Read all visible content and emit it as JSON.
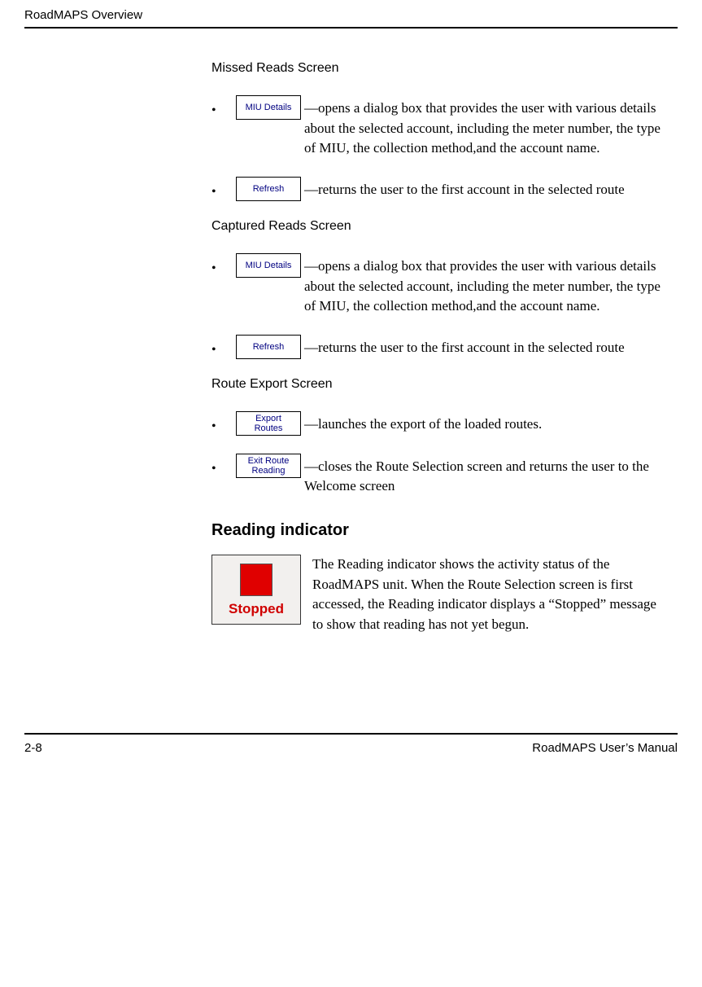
{
  "header": {
    "title": "RoadMAPS Overview"
  },
  "sections": {
    "missed": {
      "title": "Missed Reads Screen",
      "items": [
        {
          "button": "MIU Details",
          "dash": "—",
          "text": "opens a dialog box that provides the user with various details about the selected account, including the meter number, the type of MIU, the collection method,and the account name."
        },
        {
          "button": "Refresh",
          "dash": "—",
          "text": "returns the user to the first account in the selected route"
        }
      ]
    },
    "captured": {
      "title": "Captured Reads Screen",
      "items": [
        {
          "button": "MIU Details",
          "dash": "—",
          "text": "opens a dialog box that provides the user with various details about the selected account, including the meter number, the type of MIU, the collection method,and the account name."
        },
        {
          "button": "Refresh",
          "dash": "—",
          "text": "returns the user to the first account in the selected route"
        }
      ]
    },
    "route_export": {
      "title": "Route Export Screen",
      "items": [
        {
          "button": "Export\nRoutes",
          "dash": "—",
          "text": "launches the export of the loaded routes."
        },
        {
          "button": "Exit Route\nReading",
          "dash": "—",
          "text": "closes the Route Selection screen and returns the user to the Welcome screen"
        }
      ]
    }
  },
  "reading_indicator": {
    "heading": "Reading indicator",
    "label": "Stopped",
    "text": "The Reading indicator shows the activity status of the RoadMAPS unit. When the Route Selection screen is first accessed, the Reading indicator displays a “Stopped” message to show that reading has not yet begun."
  },
  "footer": {
    "page": "2-8",
    "manual": "RoadMAPS User’s Manual"
  }
}
